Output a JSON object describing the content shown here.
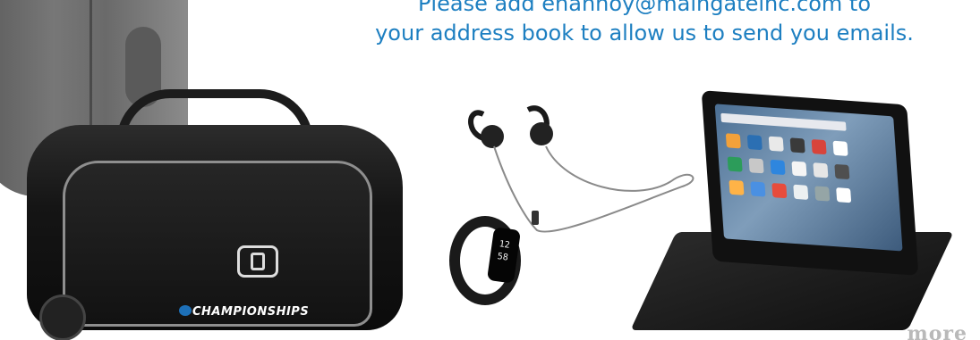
{
  "notice": {
    "line1": "Please add ehannoy@maingateinc.com to",
    "line2": "your address book to allow us to send you emails."
  },
  "bag": {
    "brand_text": "CHAMPIONSHIPS"
  },
  "band": {
    "hour": "12",
    "minute": "58"
  },
  "bottom_logo": "more",
  "colors": {
    "headline": "#1d7fc1",
    "background": "#ffffff",
    "bag": "#111111",
    "tablet_screen": "#5f81a6"
  }
}
